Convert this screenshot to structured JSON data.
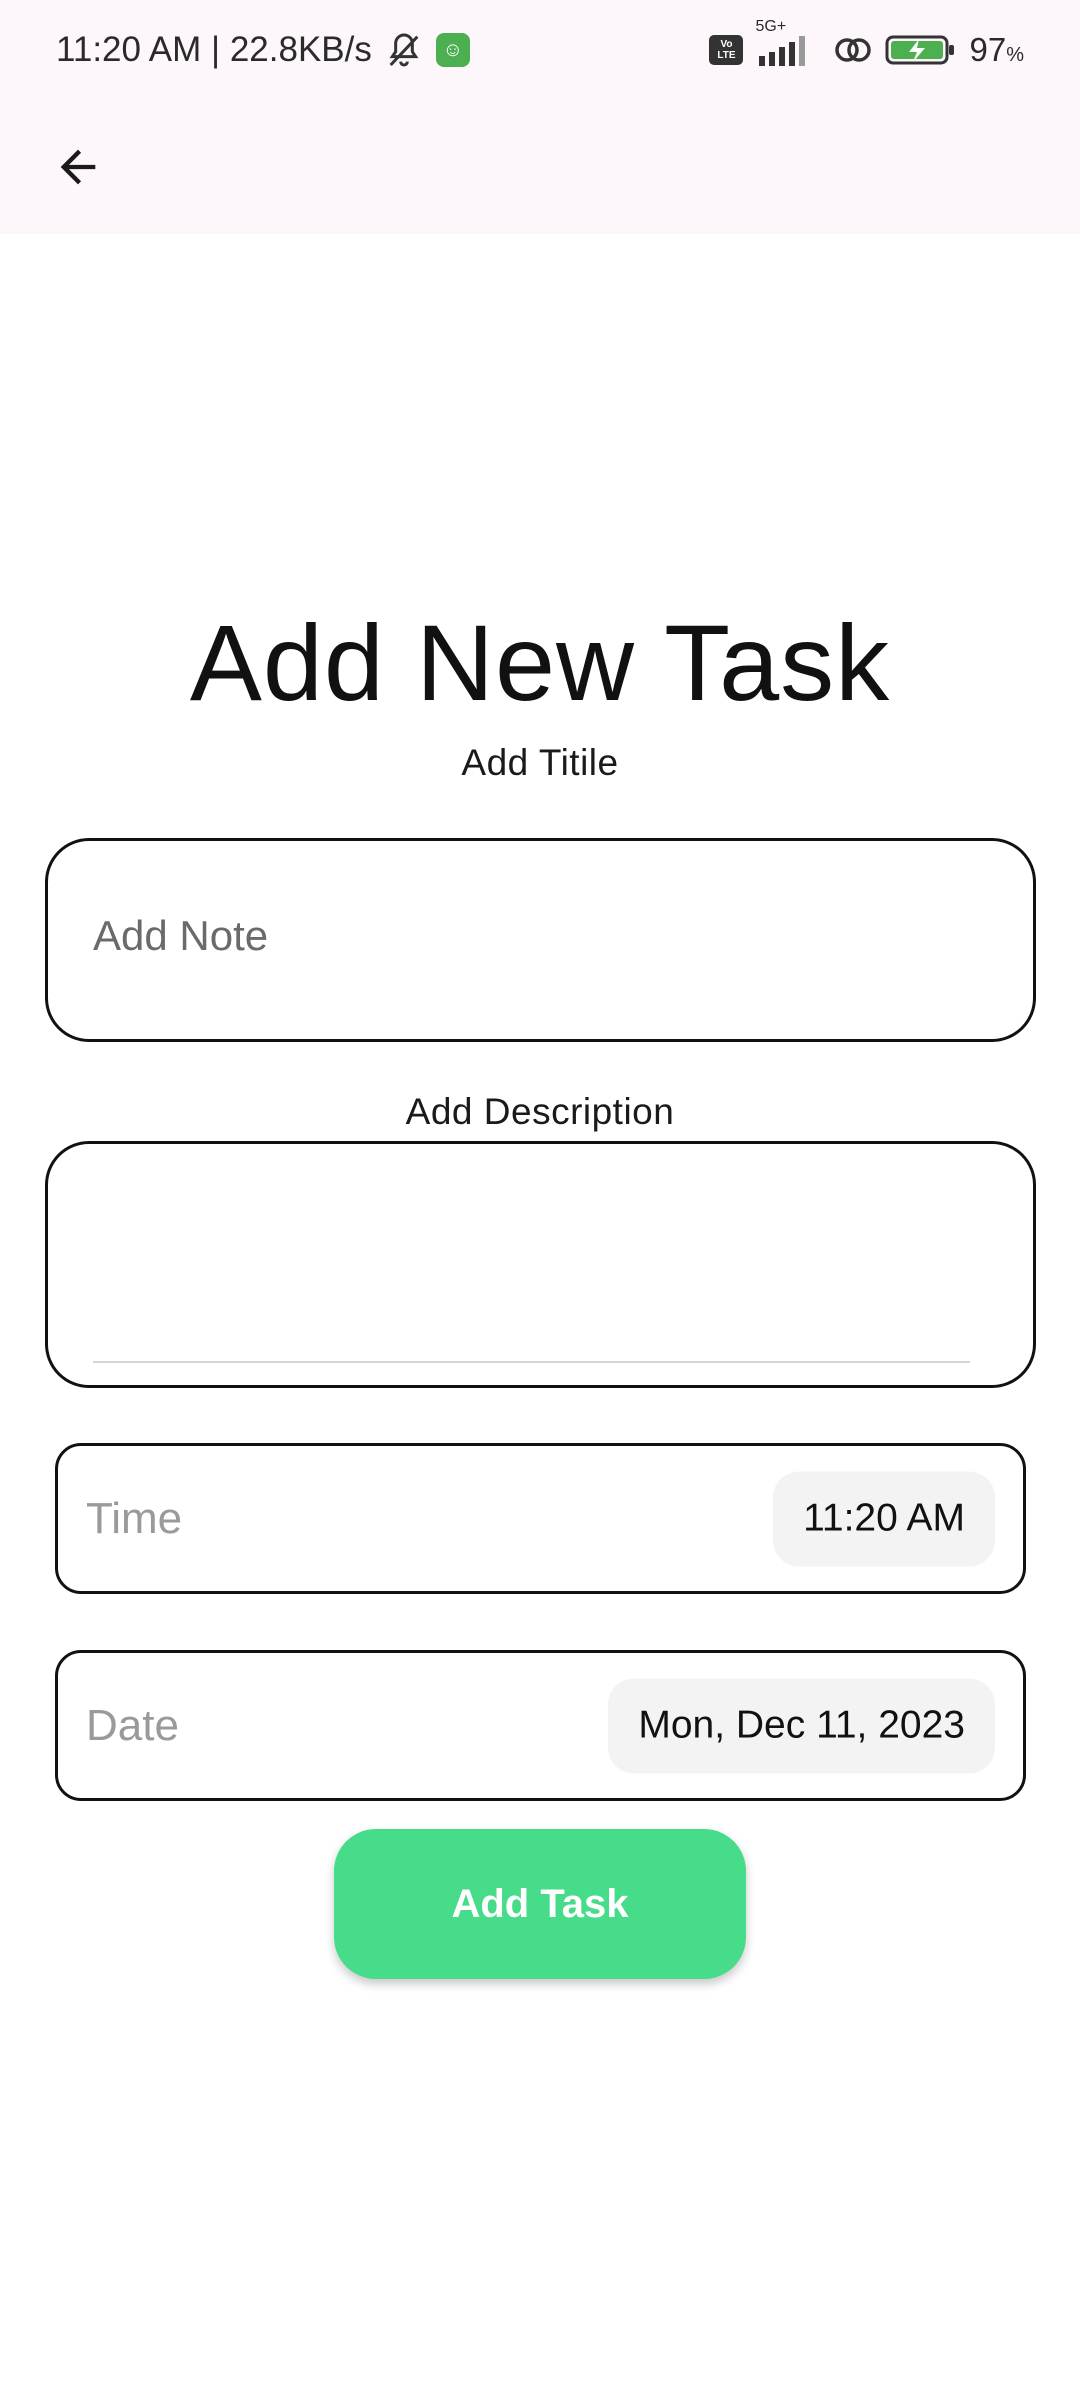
{
  "status_bar": {
    "time_speed": "11:20 AM | 22.8KB/s",
    "network": "5G+",
    "volte": [
      "Vo",
      "LTE"
    ],
    "battery": "97",
    "battery_unit": "%"
  },
  "app_bar": {
    "back_icon": "arrow-back-icon"
  },
  "page": {
    "title": "Add New Task",
    "title_label": "Add Titile",
    "note_placeholder": "Add Note",
    "description_label": "Add Description",
    "description_value": ""
  },
  "time": {
    "label": "Time",
    "value": "11:20 AM"
  },
  "date": {
    "label": "Date",
    "value": "Mon, Dec 11, 2023"
  },
  "submit": {
    "label": "Add Task"
  },
  "colors": {
    "accent": "#46dc8a",
    "top_bar_bg": "#fdf7fc",
    "chip_bg": "#f3f3f3",
    "border": "#111111"
  }
}
